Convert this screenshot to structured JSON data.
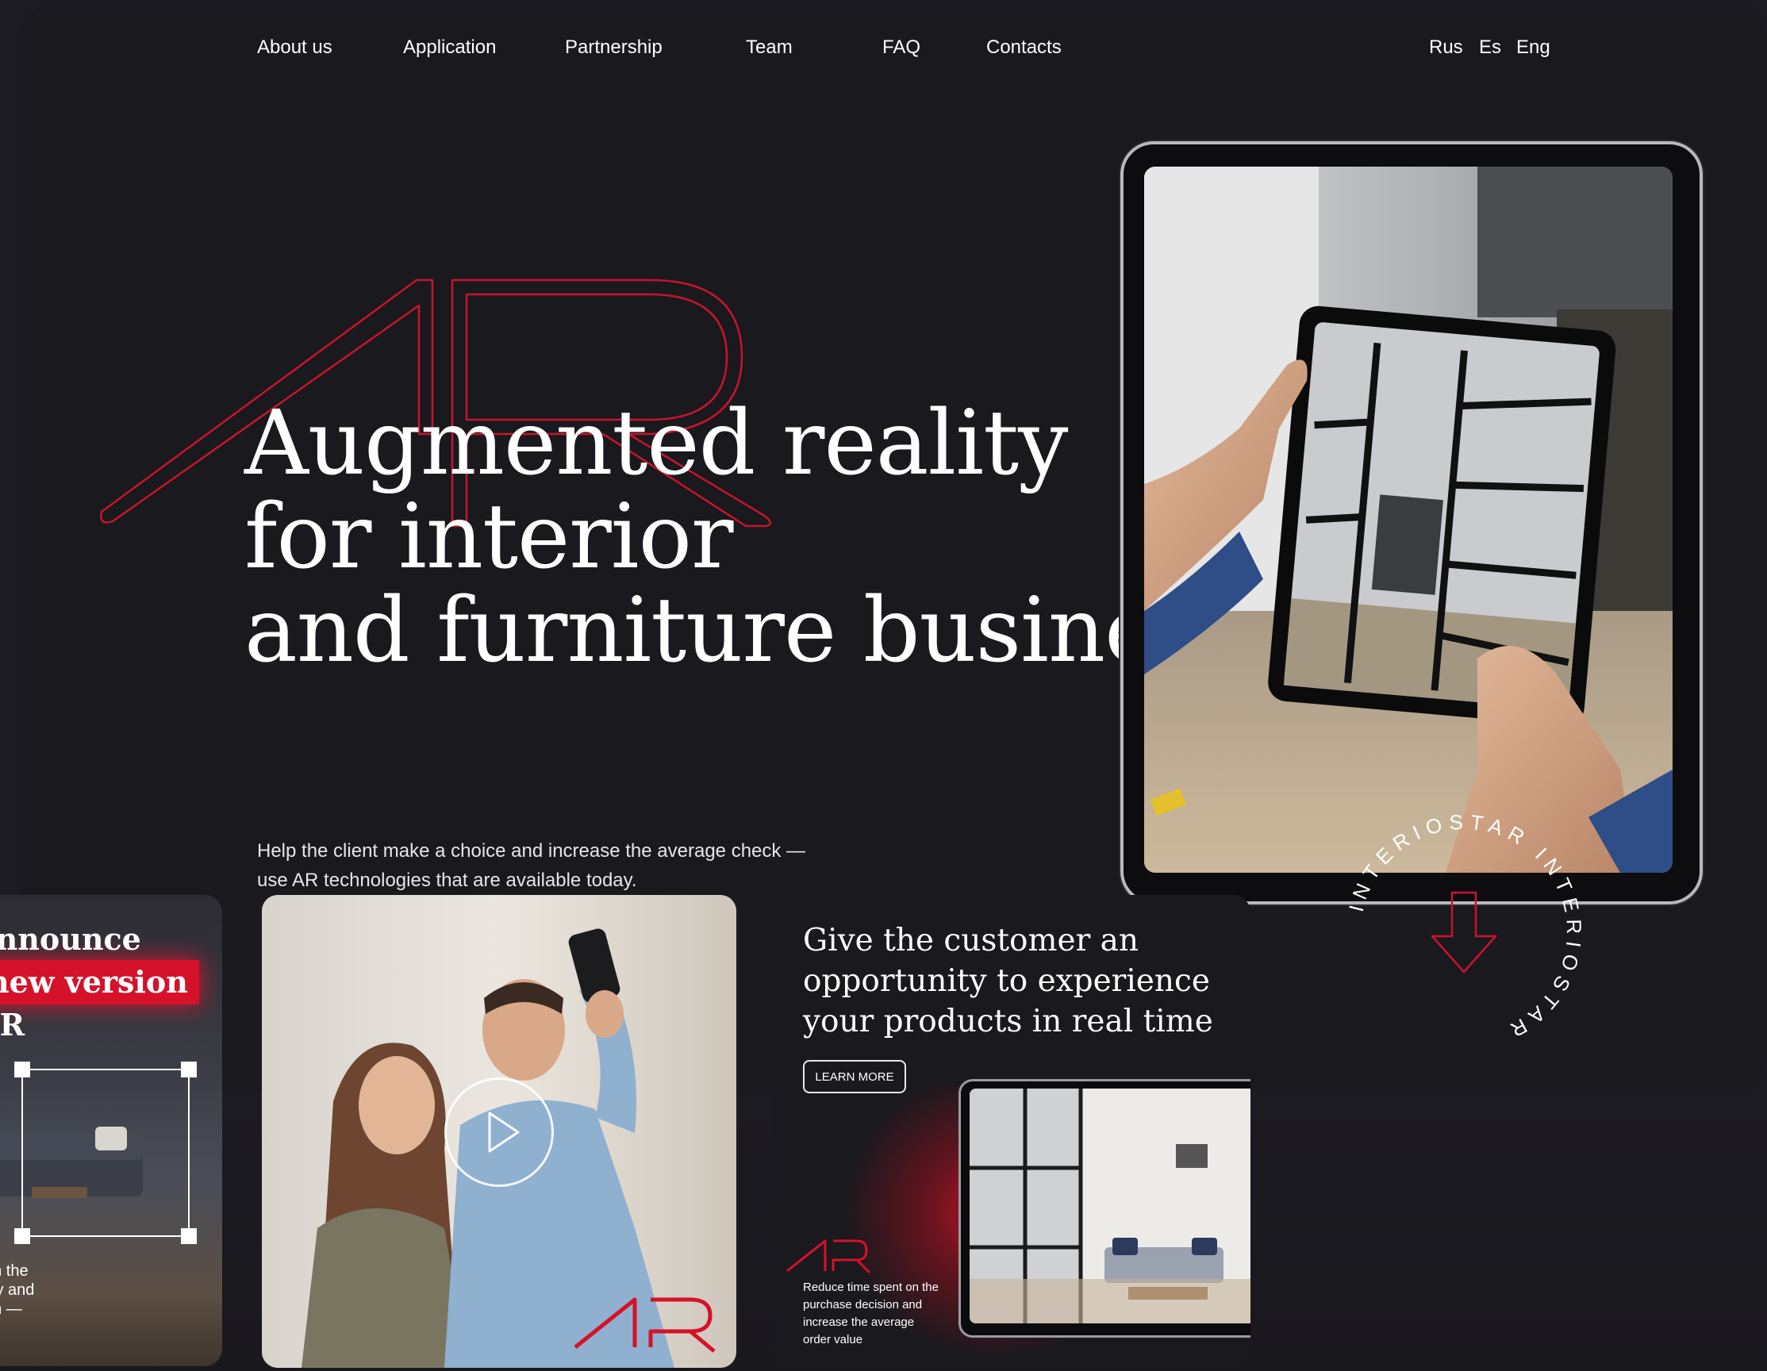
{
  "nav": {
    "items": [
      "About us",
      "Application",
      "Partnership",
      "Team",
      "FAQ",
      "Contacts"
    ],
    "languages": [
      "Rus",
      "Es",
      "Eng"
    ]
  },
  "hero": {
    "title_lines": [
      "Augmented reality",
      "for interior",
      "and furniture business"
    ],
    "subtitle_lines": [
      "Help the client make a choice and increase the average check —",
      "use AR technologies that are available today."
    ],
    "circle_text": "INTERIOSTAR INTERIOSTAR",
    "logo_text": "AR"
  },
  "cards": {
    "left": {
      "title_lines": [
        "announce",
        "new version",
        "AR"
      ],
      "caption_lines": [
        "on the",
        "lity and",
        "on —"
      ]
    },
    "video": {
      "play_icon": "play-icon",
      "logo_text": "AR"
    },
    "promo": {
      "title_lines": [
        "Give the customer an",
        "opportunity to experience",
        "your products in real time"
      ],
      "button_label": "LEARN MORE",
      "logo_text": "AR",
      "desc_lines": [
        "Reduce time spent on the",
        "purchase decision and",
        "increase the average",
        "order value"
      ]
    }
  },
  "colors": {
    "background": "#1a191e",
    "accent_red": "#d6112a",
    "text": "#ffffff"
  }
}
